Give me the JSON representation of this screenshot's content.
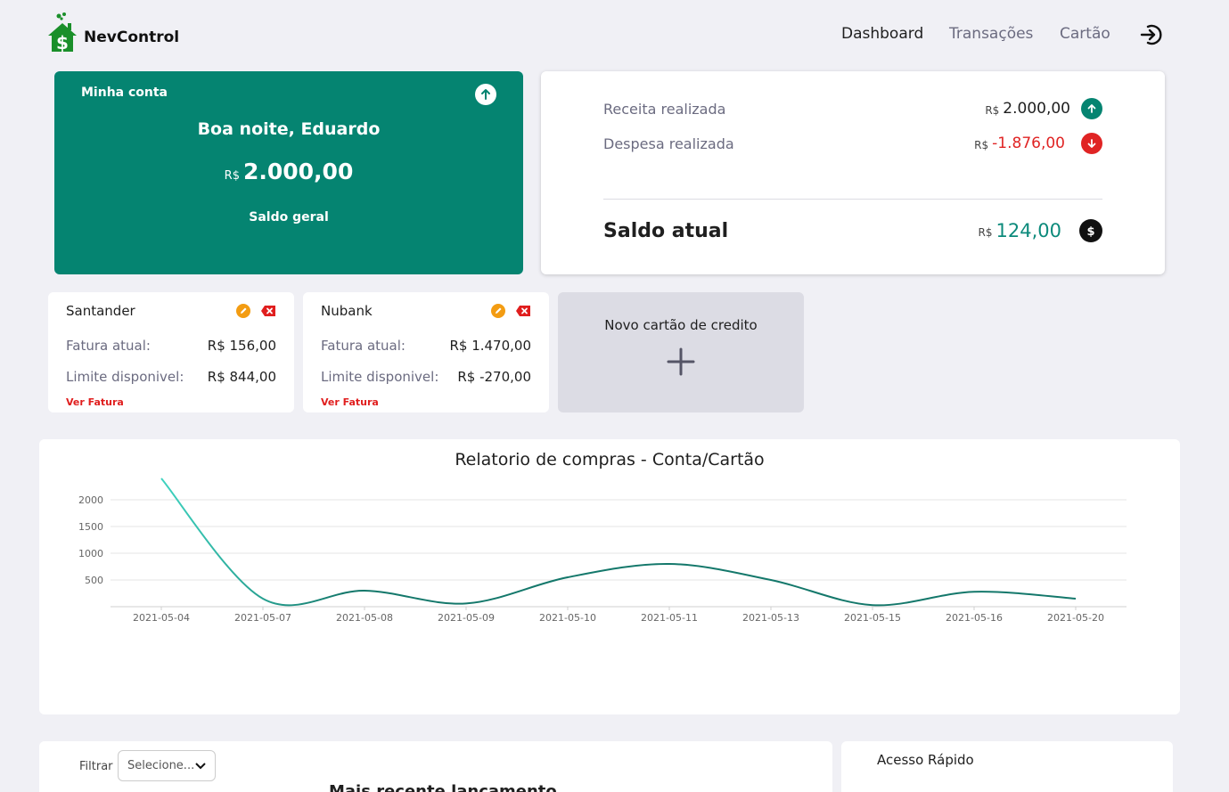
{
  "app": {
    "name": "NevControl"
  },
  "nav": {
    "items": [
      "Dashboard",
      "Transações",
      "Cartão"
    ],
    "active": "Dashboard"
  },
  "account": {
    "label": "Minha conta",
    "greeting": "Boa noite, Eduardo",
    "currency": "R$",
    "balance": "2.000,00",
    "subtitle": "Saldo geral"
  },
  "summary": {
    "income_label": "Receita realizada",
    "income_currency": "R$",
    "income_value": "2.000,00",
    "expense_label": "Despesa realizada",
    "expense_currency": "R$",
    "expense_value": "-1.876,00",
    "balance_label": "Saldo atual",
    "balance_currency": "R$",
    "balance_value": "124,00",
    "colors": {
      "income": "#058471",
      "expense": "#e02424",
      "balance": "#0c8a7b"
    }
  },
  "cards": [
    {
      "name": "Santander",
      "invoice_label": "Fatura atual:",
      "invoice": "R$ 156,00",
      "limit_label": "Limite disponivel:",
      "limit": "R$ 844,00",
      "link": "Ver Fatura"
    },
    {
      "name": "Nubank",
      "invoice_label": "Fatura atual:",
      "invoice": "R$ 1.470,00",
      "limit_label": "Limite disponivel:",
      "limit": "R$ -270,00",
      "link": "Ver Fatura"
    }
  ],
  "new_card": {
    "label": "Novo cartão de credito"
  },
  "chart_data": {
    "type": "line",
    "title": "Relatorio de compras - Conta/Cartão",
    "xlabel": "",
    "ylabel": "",
    "categories": [
      "2021-05-04",
      "2021-05-07",
      "2021-05-08",
      "2021-05-09",
      "2021-05-10",
      "2021-05-11",
      "2021-05-13",
      "2021-05-15",
      "2021-05-16",
      "2021-05-20"
    ],
    "series": [
      {
        "values": [
          2400,
          150,
          300,
          60,
          550,
          800,
          500,
          30,
          280,
          150
        ]
      }
    ],
    "yticks": [
      500,
      1000,
      1500,
      2000
    ],
    "ylim": [
      0,
      2000
    ],
    "grid": true,
    "colors": [
      "#3fd3c0",
      "#14786b"
    ]
  },
  "filter": {
    "label": "Filtrar",
    "selected": "Selecione..."
  },
  "recent": {
    "title": "Mais recente lançamento"
  },
  "quick_access": {
    "title": "Acesso Rápido"
  }
}
